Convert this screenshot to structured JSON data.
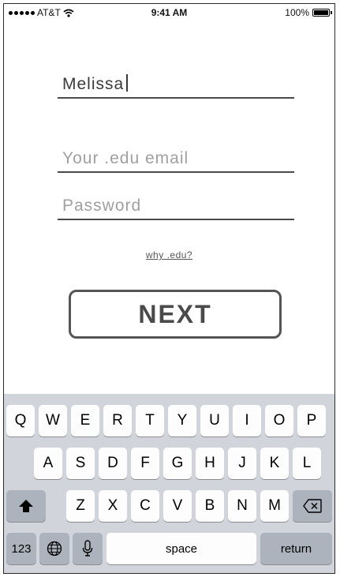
{
  "status_bar": {
    "carrier": "AT&T",
    "time": "9:41 AM",
    "battery": "100%"
  },
  "form": {
    "name_value": "Melissa",
    "email_placeholder": "Your .edu email",
    "password_placeholder": "Password",
    "why_link": "why .edu?",
    "next_label": "NEXT"
  },
  "keyboard": {
    "row1": [
      "Q",
      "W",
      "E",
      "R",
      "T",
      "Y",
      "U",
      "I",
      "O",
      "P"
    ],
    "row2": [
      "A",
      "S",
      "D",
      "F",
      "G",
      "H",
      "J",
      "K",
      "L"
    ],
    "row3": [
      "Z",
      "X",
      "C",
      "V",
      "B",
      "N",
      "M"
    ],
    "numbers_label": "123",
    "space_label": "space",
    "return_label": "return"
  }
}
